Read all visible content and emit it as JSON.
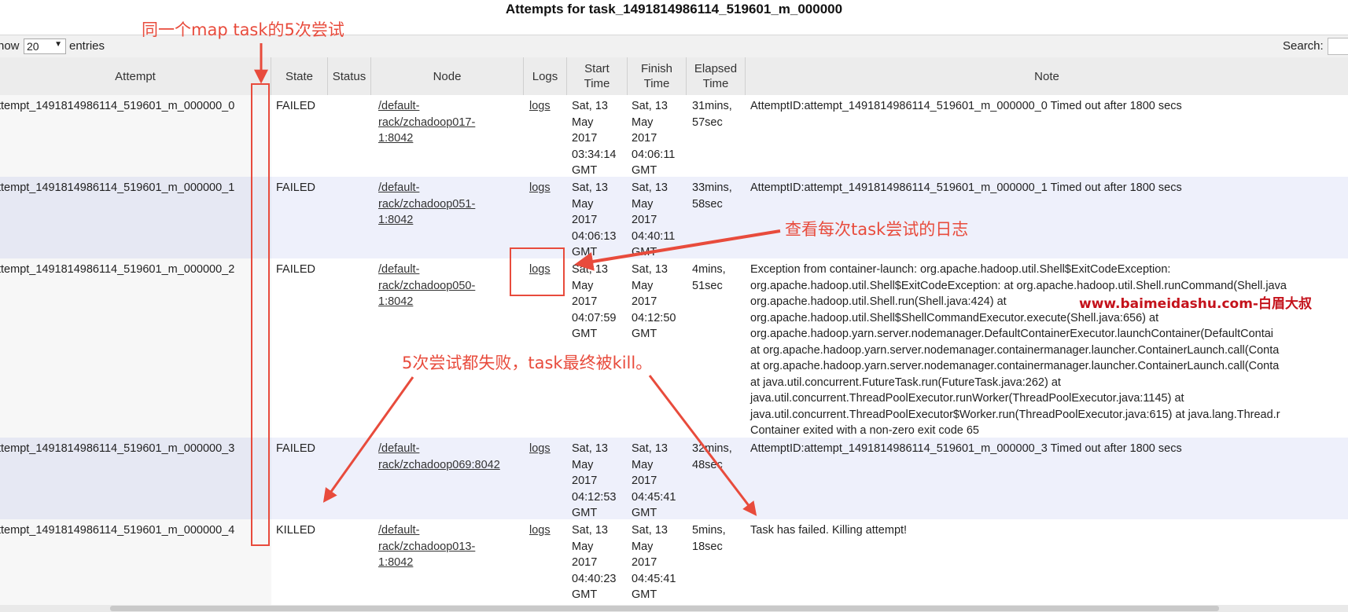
{
  "title": "Attempts for task_1491814986114_519601_m_000000",
  "controls": {
    "show_label": "how",
    "show_value": "20",
    "entries_label": "entries",
    "search_label": "Search:"
  },
  "columns": [
    "Attempt",
    "State",
    "Status",
    "Node",
    "Logs",
    "Start\nTime",
    "Finish\nTime",
    "Elapsed\nTime",
    "Note"
  ],
  "rows": [
    {
      "attempt": "ttempt_1491814986114_519601_m_000000_0",
      "state": "FAILED",
      "status": "",
      "node": "/default-\nrack/zchadoop017-\n1:8042",
      "logs": "logs",
      "start": "Sat, 13\nMay\n2017\n03:34:14\nGMT",
      "finish": "Sat, 13\nMay\n2017\n04:06:11\nGMT",
      "elapsed": "31mins,\n57sec",
      "note": "AttemptID:attempt_1491814986114_519601_m_000000_0 Timed out after 1800 secs"
    },
    {
      "attempt": "ttempt_1491814986114_519601_m_000000_1",
      "state": "FAILED",
      "status": "",
      "node": "/default-\nrack/zchadoop051-\n1:8042",
      "logs": "logs",
      "start": "Sat, 13\nMay\n2017\n04:06:13\nGMT",
      "finish": "Sat, 13\nMay\n2017\n04:40:11\nGMT",
      "elapsed": "33mins,\n58sec",
      "note": "AttemptID:attempt_1491814986114_519601_m_000000_1 Timed out after 1800 secs"
    },
    {
      "attempt": "ttempt_1491814986114_519601_m_000000_2",
      "state": "FAILED",
      "status": "",
      "node": "/default-\nrack/zchadoop050-\n1:8042",
      "logs": "logs",
      "start": "Sat, 13\nMay\n2017\n04:07:59\nGMT",
      "finish": "Sat, 13\nMay\n2017\n04:12:50\nGMT",
      "elapsed": "4mins,\n51sec",
      "note": "Exception from container-launch: org.apache.hadoop.util.Shell$ExitCodeException:\norg.apache.hadoop.util.Shell$ExitCodeException: at org.apache.hadoop.util.Shell.runCommand(Shell.java\norg.apache.hadoop.util.Shell.run(Shell.java:424) at\norg.apache.hadoop.util.Shell$ShellCommandExecutor.execute(Shell.java:656) at\norg.apache.hadoop.yarn.server.nodemanager.DefaultContainerExecutor.launchContainer(DefaultContai\nat org.apache.hadoop.yarn.server.nodemanager.containermanager.launcher.ContainerLaunch.call(Conta\nat org.apache.hadoop.yarn.server.nodemanager.containermanager.launcher.ContainerLaunch.call(Conta\nat java.util.concurrent.FutureTask.run(FutureTask.java:262) at\njava.util.concurrent.ThreadPoolExecutor.runWorker(ThreadPoolExecutor.java:1145) at\njava.util.concurrent.ThreadPoolExecutor$Worker.run(ThreadPoolExecutor.java:615) at java.lang.Thread.r\nContainer exited with a non-zero exit code 65"
    },
    {
      "attempt": "ttempt_1491814986114_519601_m_000000_3",
      "state": "FAILED",
      "status": "",
      "node": "/default-\nrack/zchadoop069:8042",
      "logs": "logs",
      "start": "Sat, 13\nMay\n2017\n04:12:53\nGMT",
      "finish": "Sat, 13\nMay\n2017\n04:45:41\nGMT",
      "elapsed": "32mins,\n48sec",
      "note": "AttemptID:attempt_1491814986114_519601_m_000000_3 Timed out after 1800 secs"
    },
    {
      "attempt": "ttempt_1491814986114_519601_m_000000_4",
      "state": "KILLED",
      "status": "",
      "node": "/default-\nrack/zchadoop013-\n1:8042",
      "logs": "logs",
      "start": "Sat, 13\nMay\n2017\n04:40:23\nGMT",
      "finish": "Sat, 13\nMay\n2017\n04:45:41\nGMT",
      "elapsed": "5mins,\n18sec",
      "note": "Task has failed. Killing attempt!"
    }
  ],
  "annotations": {
    "same_task": "同一个map task的5次尝试",
    "view_logs": "查看每次task尝试的日志",
    "all_failed": "5次尝试都失败，task最终被kill。",
    "watermark": "www.baimeidashu.com-白眉大叔"
  },
  "colors": {
    "annotation": "#e84b3c",
    "watermark": "#c4121b",
    "row_even": "#eef0fb",
    "header_bg": "#ececec"
  }
}
